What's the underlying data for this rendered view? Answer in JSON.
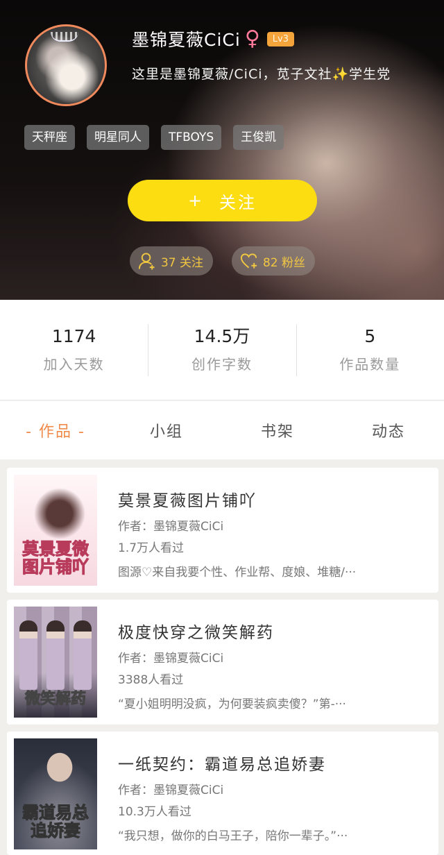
{
  "profile": {
    "username": "墨锦夏薇CiCi",
    "gender_icon": "female-icon",
    "level": "Lv3",
    "bio": "这里是墨锦夏薇/CiCi，苋子文社✨学生党",
    "tags": [
      "天秤座",
      "明星同人",
      "TFBOYS",
      "王俊凯"
    ],
    "follow_button": "关注",
    "following_text": "37 关注",
    "fans_text": "82 粉丝"
  },
  "stats": [
    {
      "value": "1174",
      "label": "加入天数"
    },
    {
      "value": "14.5万",
      "label": "创作字数"
    },
    {
      "value": "5",
      "label": "作品数量"
    }
  ],
  "tabs": [
    {
      "label": "- 作品 -",
      "active": true
    },
    {
      "label": "小组",
      "active": false
    },
    {
      "label": "书架",
      "active": false
    },
    {
      "label": "动态",
      "active": false
    }
  ],
  "works": [
    {
      "title": "莫景夏薇图片铺吖",
      "author": "作者：墨锦夏薇CiCi",
      "views": "1.7万人看过",
      "desc": "图源♡来自我要个性、作业帮、度娘、堆糖/···",
      "cover_text": "莫景夏微 图片铺吖"
    },
    {
      "title": "极度快穿之微笑解药",
      "author": "作者：墨锦夏薇CiCi",
      "views": "3388人看过",
      "desc": "“夏小姐明明没疯，为何要装疯卖傻？”第-···",
      "cover_text": "微笑解药"
    },
    {
      "title": "一纸契约：霸道易总追娇妻",
      "author": "作者：墨锦夏薇CiCi",
      "views": "10.3万人看过",
      "desc": "“我只想，做你的白马王子，陪你一辈子。”···",
      "cover_text": "霸道易总 追娇妻"
    }
  ],
  "colors": {
    "accent": "#fbdd12",
    "tab_active": "#f08a4a",
    "level_badge": "#f3a43b",
    "pill_text": "#f1c742"
  }
}
